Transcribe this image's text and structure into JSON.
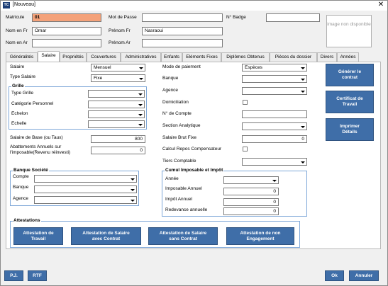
{
  "window": {
    "title": "[Nouveau]",
    "icon": "app-logo-icon",
    "close": "✕"
  },
  "header": {
    "matricule_label": "Matricule",
    "matricule_value": "01",
    "mot_de_passe_label": "Mot de Passe",
    "mot_de_passe_value": "",
    "badge_label": "N° Badge",
    "badge_value": "",
    "nom_fr_label": "Nom en Fr",
    "nom_fr_value": "Omar",
    "prenom_fr_label": "Prénom Fr",
    "prenom_fr_value": "Nasraoui",
    "nom_ar_label": "Nom en Ar",
    "nom_ar_value": "",
    "prenom_ar_label": "Prénom Ar",
    "prenom_ar_value": "",
    "image_placeholder": "image non disponible"
  },
  "tabs": [
    "Généralités",
    "Salaire",
    "Propriétés",
    "Couvertures",
    "Administratives",
    "Enfants",
    "Eléments Fixes",
    "Diplômes Obtenus",
    "Pièces du dossier",
    "Divers",
    "Années"
  ],
  "active_tab": "Salaire",
  "left": {
    "salaire_label": "Salaire",
    "salaire_value": "Mensuel",
    "type_salaire_label": "Type Salaire",
    "type_salaire_value": "Fixe",
    "grille_title": "Grille",
    "type_grille_label": "Type Grille",
    "categorie_label": "Catégorie Personnel",
    "echelon_label": "Echelon",
    "echelle_label": "Echelle",
    "salaire_base_label": "Salaire de Base (ou Taux)",
    "salaire_base_value": "800",
    "abattements_label_1": "Abattements Annuels sur",
    "abattements_label_2": "l'imposable(Revenu réinvesti)",
    "abattements_value": "0"
  },
  "banque_societe": {
    "title": "Banque Société",
    "compte_label": "Compte",
    "banque_label": "Banque",
    "agence_label": "Agence"
  },
  "middle": {
    "mode_paiement_label": "Mode de paiement",
    "mode_paiement_value": "Espèces",
    "banque_label": "Banque",
    "agence_label": "Agence",
    "domiciliation_label": "Domiciliation",
    "num_compte_label": "N° de Compte",
    "section_label": "Section Analytique",
    "salaire_brut_label": "Salaire Brut Fixe",
    "salaire_brut_value": "0",
    "calcul_repos_label": "Calcul Repos Compensateur",
    "tiers_label": "Tiers Comptable"
  },
  "cumul": {
    "title": "Cumul Imposable et Impôt",
    "annee_label": "Année",
    "imposable_label": "Imposable Annuel",
    "imposable_value": "0",
    "impot_label": "Impôt Annuel",
    "impot_value": "0",
    "redevance_label": "Redevance annuelle",
    "redevance_value": "0"
  },
  "side_buttons": {
    "generer": [
      "Générer le",
      "contrat"
    ],
    "certificat": [
      "Certificat de",
      "Travail"
    ],
    "imprimer": [
      "Imprimer",
      "Détails"
    ]
  },
  "attestations": {
    "title": "Attestations",
    "b1": [
      "Attestation de",
      "Travail"
    ],
    "b2": [
      "Attestation de Salaire",
      "avec Contrat"
    ],
    "b3": [
      "Attestation de Salaire",
      "sans Contrat"
    ],
    "b4": [
      "Attestation de non",
      "Engagement"
    ]
  },
  "footer": {
    "pj": "P.J.",
    "rtf": "RTF",
    "ok": "Ok",
    "annuler": "Annuler"
  },
  "colors": {
    "accent": "#3f6ea8",
    "orange_field": "#f4a27a",
    "group_border": "#7ea7d8"
  }
}
